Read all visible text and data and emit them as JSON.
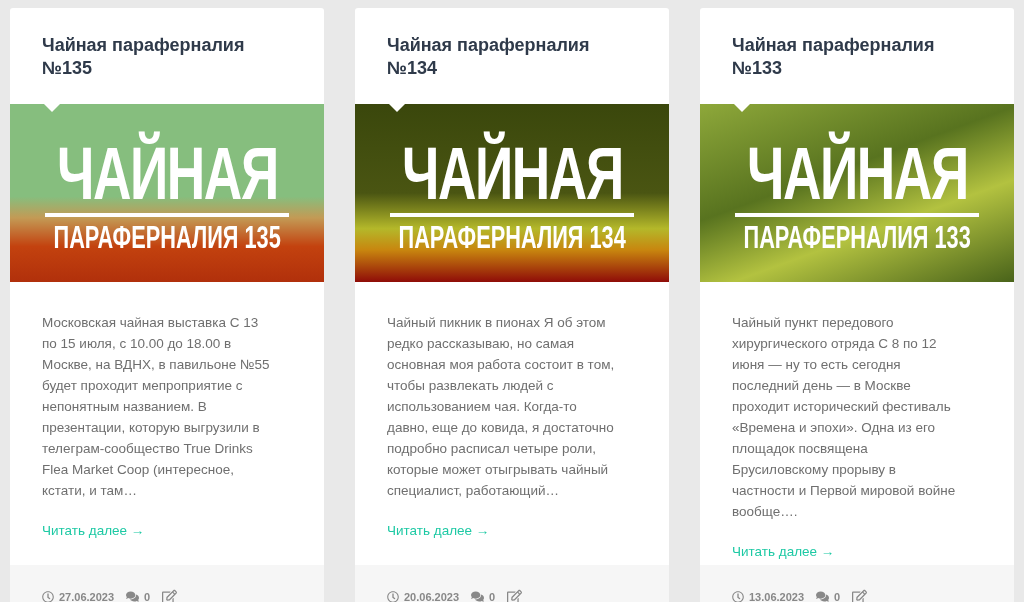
{
  "posts": [
    {
      "title": "Чайная параферналия №135",
      "cover": {
        "headline": "ЧАЙНАЯ",
        "subtitle": "ПАРАФЕРНАЛИЯ 135"
      },
      "excerpt": "Московская чайная выставка С 13 по 15 июля, с 10.00 до 18.00 в Москве, на ВДНХ, в павильоне №55 будет проходит мепроприятие с непонятным названием. В презентации, которую выгрузили в телеграм-сообщество True Drinks Flea Market Coop (интересное, кстати, и там…",
      "read_more": "Читать далее →",
      "date": "27.06.2023",
      "comments": "0"
    },
    {
      "title": "Чайная параферналия №134",
      "cover": {
        "headline": "ЧАЙНАЯ",
        "subtitle": "ПАРАФЕРНАЛИЯ 134"
      },
      "excerpt": "Чайный пикник в пионах Я об этом редко рассказываю, но самая основная моя работа состоит в том, чтобы развлекать людей с использованием чая. Когда-то давно, еще до ковида, я достаточно подробно расписал четыре роли, которые может отыгрывать чайный специалист, работающий…",
      "read_more": "Читать далее →",
      "date": "20.06.2023",
      "comments": "0"
    },
    {
      "title": "Чайная параферналия №133",
      "cover": {
        "headline": "ЧАЙНАЯ",
        "subtitle": "ПАРАФЕРНАЛИЯ 133"
      },
      "excerpt": "Чайный пункт передового хирургического отряда С 8 по 12 июня — ну то есть сегодня последний день — в Москве проходит исторический фестиваль «Времена и эпохи». Одна из его площадок посвящена Брусиловскому прорыву в частности и Первой мировой войне вообще….",
      "read_more": "Читать далее →",
      "date": "13.06.2023",
      "comments": "0"
    }
  ]
}
